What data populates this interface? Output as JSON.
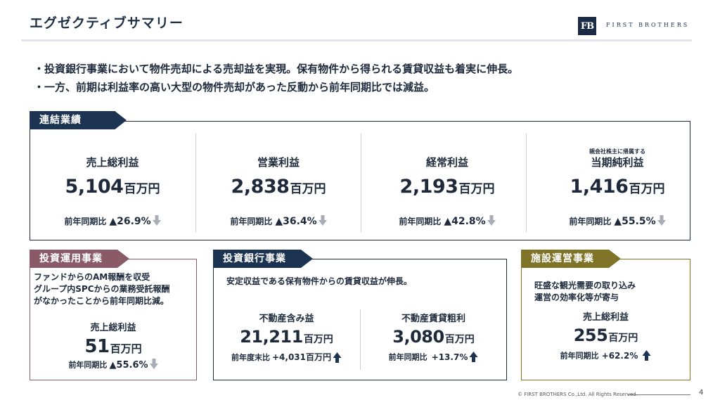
{
  "header": {
    "title": "エグゼクティブサマリー",
    "logo_mark": "FB",
    "logo_text": "FIRST BROTHERS"
  },
  "bullets": [
    "・投資銀行事業において物件売却による売却益を実現。保有物件から得られる賃貸収益も着実に伸長。",
    "・一方、前期は利益率の高い大型の物件売却があった反動から前年同期比では減益。"
  ],
  "consolidated": {
    "tab": "連結業績",
    "items": [
      {
        "note": "",
        "label": "売上総利益",
        "value": "5,104",
        "unit": "百万円",
        "yoy_label": "前年同期比",
        "yoy_value": "▲26.9%",
        "direction": "down"
      },
      {
        "note": "",
        "label": "営業利益",
        "value": "2,838",
        "unit": "百万円",
        "yoy_label": "前年同期比",
        "yoy_value": "▲36.4%",
        "direction": "down"
      },
      {
        "note": "",
        "label": "経常利益",
        "value": "2,193",
        "unit": "百万円",
        "yoy_label": "前年同期比",
        "yoy_value": "▲42.8%",
        "direction": "down"
      },
      {
        "note": "親会社株主に帰属する",
        "label": "当期純利益",
        "value": "1,416",
        "unit": "百万円",
        "yoy_label": "前年同期比",
        "yoy_value": "▲55.5%",
        "direction": "down"
      }
    ]
  },
  "investment_mgmt": {
    "tab": "投資運用事業",
    "desc": [
      "ファンドからのAM報酬を収受",
      "グループ内SPCからの業務受託報酬",
      "がなかったことから前年同期比減。"
    ],
    "label": "売上総利益",
    "value": "51",
    "unit": "百万円",
    "yoy_label": "前年同期比",
    "yoy_value": "▲55.6%",
    "direction": "down"
  },
  "investment_banking": {
    "tab": "投資銀行事業",
    "desc": "安定収益である保有物件からの賃貸収益が伸長。",
    "left": {
      "label": "不動産含み益",
      "value": "21,211",
      "unit": "百万円",
      "yoy_label": "前年度末比",
      "yoy_value": "+4,031百万円",
      "direction": "up"
    },
    "right": {
      "label": "不動産賃貸粗利",
      "value": "3,080",
      "unit": "百万円",
      "yoy_label": "前年同期比",
      "yoy_value": "+13.7%",
      "direction": "up"
    }
  },
  "facility_ops": {
    "tab": "施設運営事業",
    "desc": [
      "旺盛な観光需要の取り込み",
      "運営の効率化等が寄与"
    ],
    "label": "売上総利益",
    "value": "255",
    "unit": "百万円",
    "yoy_label": "前年同期比",
    "yoy_value": "+62.2%",
    "direction": "up"
  },
  "footer": {
    "copyright": "© FIRST BROTHERS Co.,Ltd. All Rights Reserved.",
    "page": "4"
  },
  "colors": {
    "navy": "#1c3452",
    "mauve": "#8a5a68",
    "olive": "#7e7326",
    "arrow_down": "#a9adb5",
    "arrow_up": "#1c3452"
  }
}
